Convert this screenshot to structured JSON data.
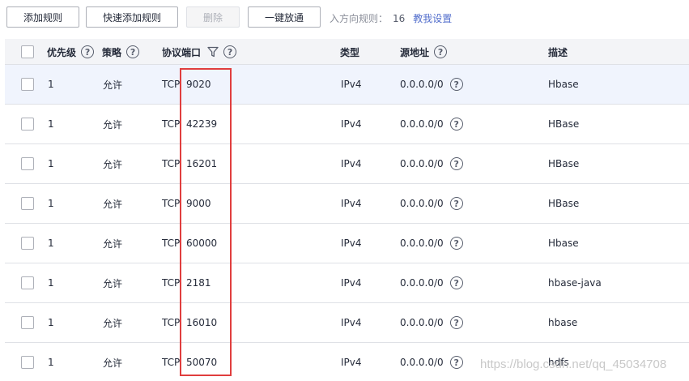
{
  "toolbar": {
    "add_rule": "添加规则",
    "quick_add_rule": "快速添加规则",
    "delete": "删除",
    "allow_all": "一键放通",
    "inbound_rules_label": "入方向规则：",
    "inbound_rules_count": "16",
    "tutorial_link": "教我设置"
  },
  "table": {
    "headers": {
      "priority": "优先级",
      "policy": "策略",
      "protocol_port": "协议端口",
      "type": "类型",
      "source": "源地址",
      "description": "描述"
    },
    "rows": [
      {
        "priority": "1",
        "policy": "允许",
        "protocol": "TCP",
        "port": "9020",
        "type": "IPv4",
        "source": "0.0.0.0/0",
        "description": "Hbase"
      },
      {
        "priority": "1",
        "policy": "允许",
        "protocol": "TCP",
        "port": "42239",
        "type": "IPv4",
        "source": "0.0.0.0/0",
        "description": "HBase"
      },
      {
        "priority": "1",
        "policy": "允许",
        "protocol": "TCP",
        "port": "16201",
        "type": "IPv4",
        "source": "0.0.0.0/0",
        "description": "HBase"
      },
      {
        "priority": "1",
        "policy": "允许",
        "protocol": "TCP",
        "port": "9000",
        "type": "IPv4",
        "source": "0.0.0.0/0",
        "description": "HBase"
      },
      {
        "priority": "1",
        "policy": "允许",
        "protocol": "TCP",
        "port": "60000",
        "type": "IPv4",
        "source": "0.0.0.0/0",
        "description": "Hbase"
      },
      {
        "priority": "1",
        "policy": "允许",
        "protocol": "TCP",
        "port": "2181",
        "type": "IPv4",
        "source": "0.0.0.0/0",
        "description": "hbase-java"
      },
      {
        "priority": "1",
        "policy": "允许",
        "protocol": "TCP",
        "port": "16010",
        "type": "IPv4",
        "source": "0.0.0.0/0",
        "description": "hbase"
      },
      {
        "priority": "1",
        "policy": "允许",
        "protocol": "TCP",
        "port": "50070",
        "type": "IPv4",
        "source": "0.0.0.0/0",
        "description": "hdfs"
      }
    ]
  },
  "watermark": "https://blog.csdn.net/qq_45034708",
  "colors": {
    "highlight_border": "#e03e3e",
    "link": "#526ecc",
    "header_bg": "#f3f4f7",
    "hover_row_bg": "#f0f4fd"
  }
}
